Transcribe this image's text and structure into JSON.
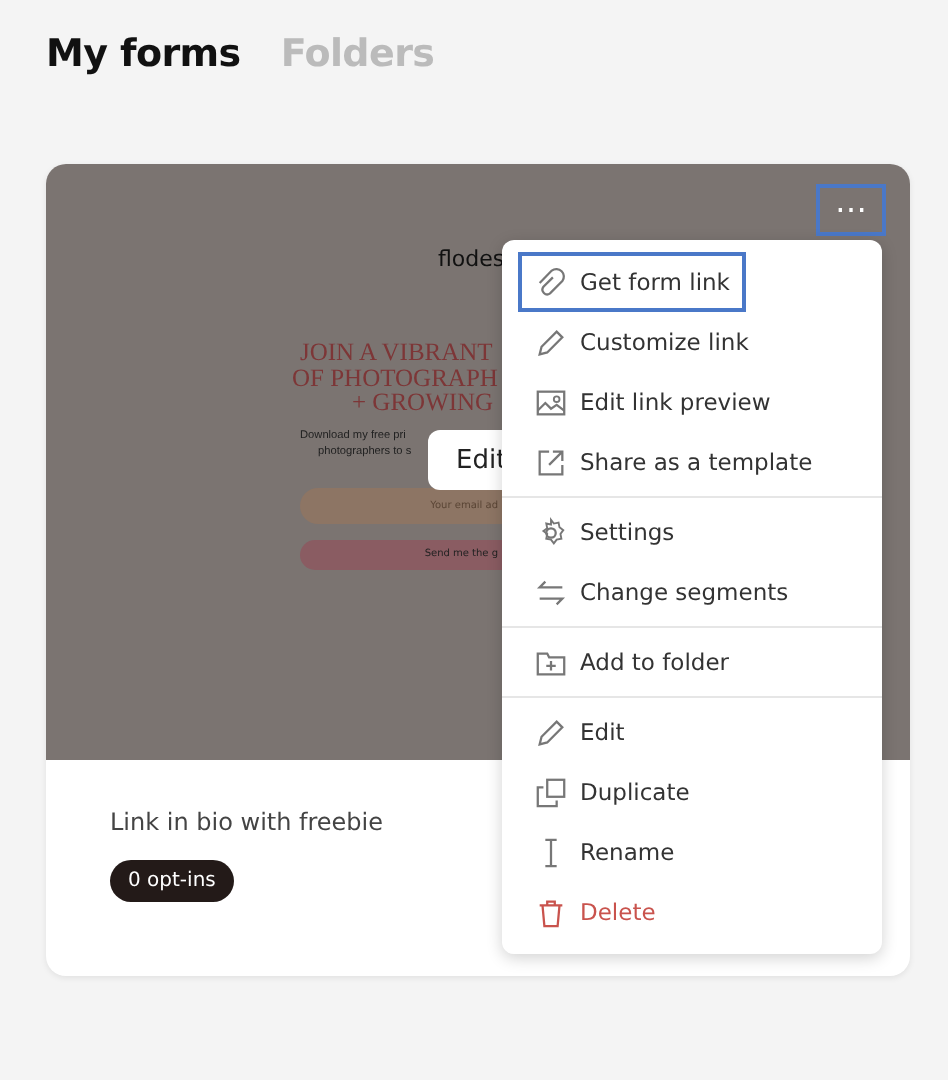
{
  "tabs": [
    {
      "label": "My forms",
      "selected": true
    },
    {
      "label": "Folders",
      "selected": false
    }
  ],
  "form_card": {
    "preview": {
      "brand": "flodes",
      "headline": [
        "JOIN A VIBRANT",
        "OF PHOTOGRAPH",
        "+ GROWING"
      ],
      "description": [
        "Download my free pri",
        "photographers to s"
      ],
      "email_placeholder": "Your email ad",
      "submit": "Send me the g"
    },
    "edit_button": "Edit",
    "more_button": {
      "label": "⋯",
      "focused": true
    },
    "name": "Link in bio with freebie",
    "badge": "0 opt-ins"
  },
  "menu": {
    "groups": [
      [
        {
          "label": "Get form link",
          "kind": "normal",
          "selected": true
        },
        {
          "label": "Customize link",
          "kind": "normal",
          "selected": false
        },
        {
          "label": "Edit link preview",
          "kind": "normal",
          "selected": false
        },
        {
          "label": "Share as a template",
          "kind": "normal",
          "selected": false
        }
      ],
      [
        {
          "label": "Settings",
          "kind": "normal",
          "selected": false
        },
        {
          "label": "Change segments",
          "kind": "normal",
          "selected": false
        }
      ],
      [
        {
          "label": "Add to folder",
          "kind": "normal",
          "selected": false
        }
      ],
      [
        {
          "label": "Edit",
          "kind": "normal",
          "selected": false
        },
        {
          "label": "Duplicate",
          "kind": "normal",
          "selected": false
        },
        {
          "label": "Rename",
          "kind": "normal",
          "selected": false
        },
        {
          "label": "Delete",
          "kind": "danger",
          "selected": false
        }
      ]
    ]
  }
}
